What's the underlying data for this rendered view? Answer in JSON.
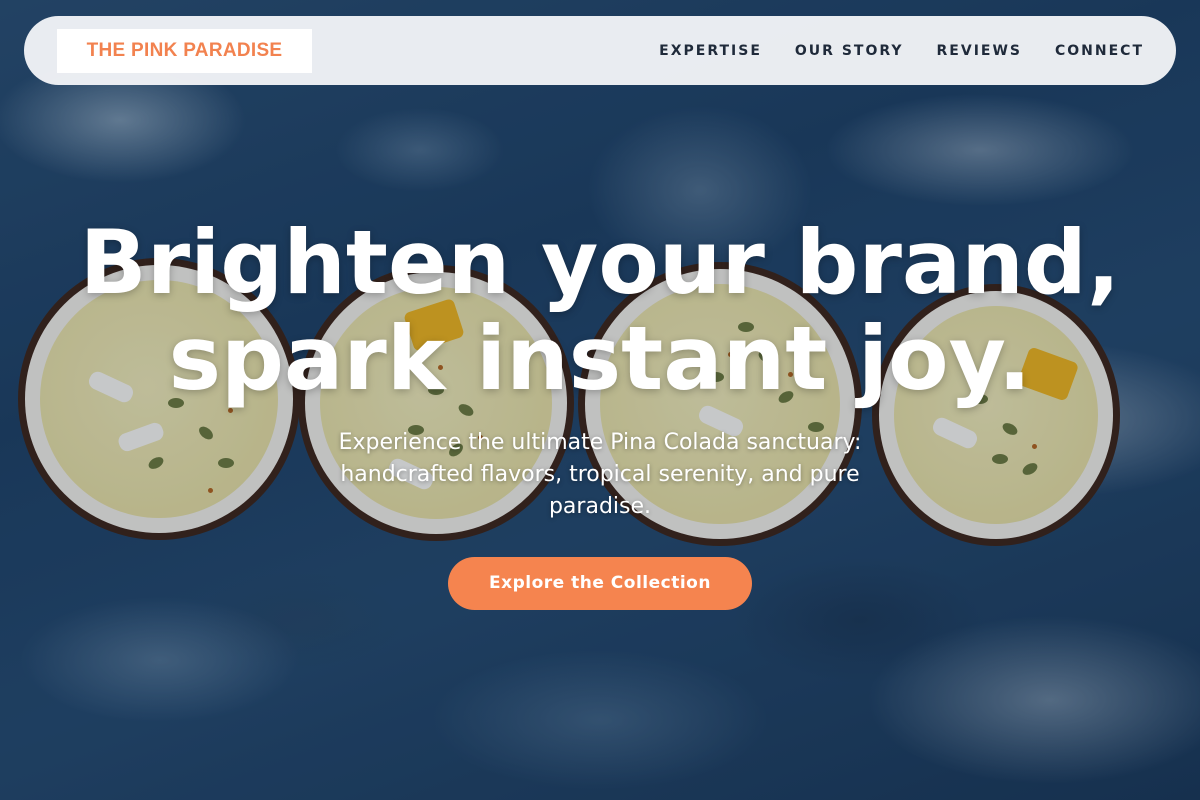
{
  "brand": {
    "logo_text": "THE PINK PARADISE",
    "accent_color": "#f5844f"
  },
  "nav": {
    "items": [
      {
        "label": "EXPERTISE"
      },
      {
        "label": "OUR STORY"
      },
      {
        "label": "REVIEWS"
      },
      {
        "label": "CONNECT"
      }
    ]
  },
  "hero": {
    "title_line1": "Brighten your brand,",
    "title_line2": "spark instant joy.",
    "subtitle": "Experience the ultimate Pina Colada sanctuary: handcrafted flavors, tropical serenity, and pure paradise.",
    "cta_label": "Explore the Collection"
  }
}
